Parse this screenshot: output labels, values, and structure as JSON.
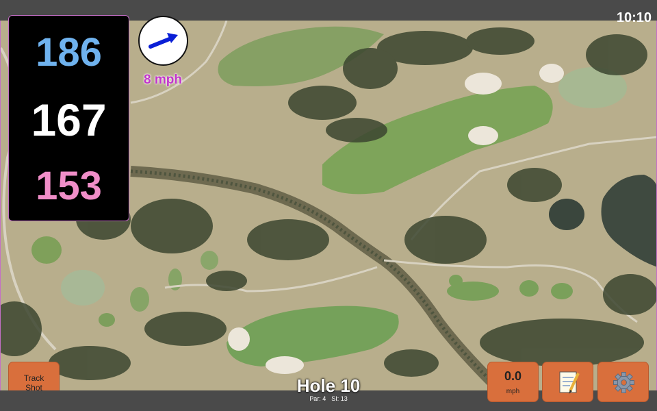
{
  "status_bar": {
    "time": "10:10"
  },
  "distances": {
    "back": "186",
    "middle": "167",
    "front": "153"
  },
  "wind": {
    "speed_label": "8 mph",
    "direction_icon": "arrow-icon"
  },
  "hole": {
    "title": "Hole 10",
    "par_label": "Par: 4",
    "si_label": "SI: 13"
  },
  "buttons": {
    "track_shot_line1": "Track",
    "track_shot_line2": "Shot",
    "speed_value": "0.0",
    "speed_unit": "mph",
    "notes_icon": "notepad-icon",
    "settings_icon": "gear-icon"
  },
  "colors": {
    "back_distance": "#6fb2ee",
    "middle_distance": "#ffffff",
    "front_distance": "#f08ec8",
    "button": "#d96f3c",
    "wind_text": "#c235cc"
  }
}
